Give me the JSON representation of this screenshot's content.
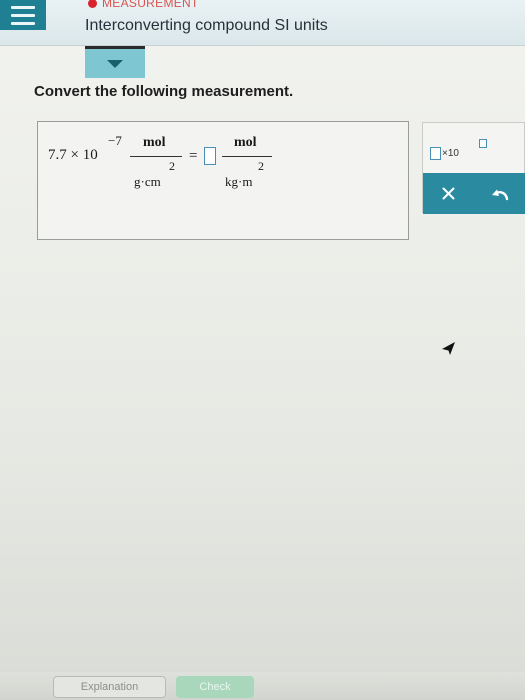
{
  "header": {
    "category": "MEASUREMENT",
    "title": "Interconverting compound SI units"
  },
  "prompt": "Convert the following measurement.",
  "problem": {
    "given_value": "7.7 × 10",
    "given_exponent": "−7",
    "given_unit_numerator": "mol",
    "given_unit_denominator": "g·cm",
    "given_unit_denominator_exponent": "2",
    "equals": "=",
    "answer_value": "",
    "target_unit_numerator": "mol",
    "target_unit_denominator": "kg·m",
    "target_unit_denominator_exponent": "2"
  },
  "tools": {
    "sci_notation_label": "×10",
    "clear_icon": "close-icon",
    "undo_icon": "undo-icon"
  },
  "footer": {
    "explanation_label": "Explanation",
    "check_label": "Check"
  },
  "colors": {
    "accent": "#2a8aa0",
    "menu": "#1f7f93",
    "input_border": "#4a8fb8",
    "check": "#a8d7bb",
    "category_dot": "#d9232e"
  }
}
